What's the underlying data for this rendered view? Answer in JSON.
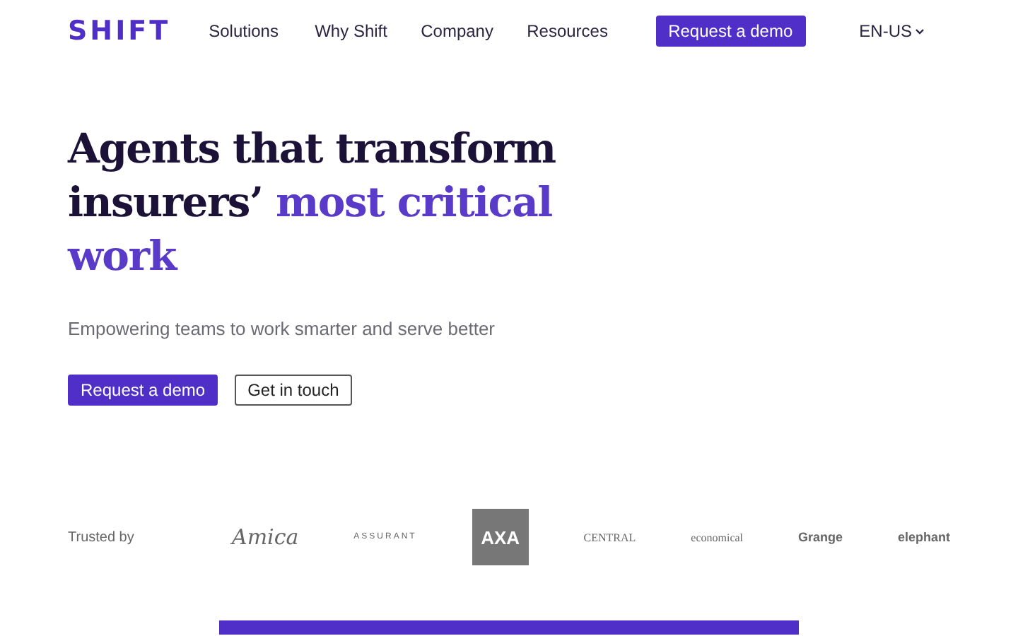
{
  "header": {
    "logo": "SHIFT",
    "nav": [
      "Solutions",
      "Why Shift",
      "Company",
      "Resources"
    ],
    "cta": "Request a demo",
    "language": "EN-US"
  },
  "hero": {
    "heading": [
      {
        "text": "Agents that transform insurers’ ",
        "accent": false
      },
      {
        "text": "most critical work",
        "accent": true
      }
    ],
    "subtitle": "Empowering teams to work smarter and serve better",
    "buttons": [
      {
        "label": "Request a demo",
        "kind": "primary"
      },
      {
        "label": "Get in touch",
        "kind": "outline"
      }
    ]
  },
  "trusted": {
    "label": "Trusted by",
    "logos": [
      {
        "text": "Amica",
        "kind": "script"
      },
      {
        "text": "ASSURANT",
        "kind": "caps"
      },
      {
        "text": "AXA",
        "kind": "block"
      },
      {
        "text": "CENTRAL",
        "kind": "serif"
      },
      {
        "text": "economical",
        "kind": "serif"
      },
      {
        "text": "Grange",
        "kind": "bold"
      },
      {
        "text": "elephant",
        "kind": "bold"
      }
    ]
  }
}
